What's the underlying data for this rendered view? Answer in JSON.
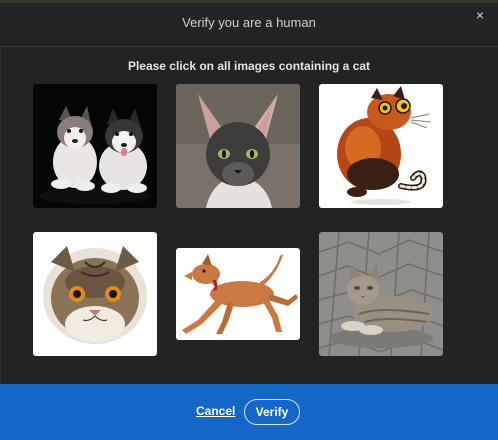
{
  "dialog": {
    "title": "Verify you are a human",
    "close_icon": "close-icon",
    "close_glyph": "×"
  },
  "challenge": {
    "prompt": "Please click on all images containing a cat",
    "images": [
      {
        "subject": "husky-puppies"
      },
      {
        "subject": "sphynx-cat"
      },
      {
        "subject": "cartoon-cat"
      },
      {
        "subject": "persian-cat-painting"
      },
      {
        "subject": "running-dog"
      },
      {
        "subject": "tabby-cat-on-pavement"
      }
    ]
  },
  "footer": {
    "cancel_label": "Cancel",
    "verify_label": "Verify",
    "background_color": "#1467c6"
  }
}
